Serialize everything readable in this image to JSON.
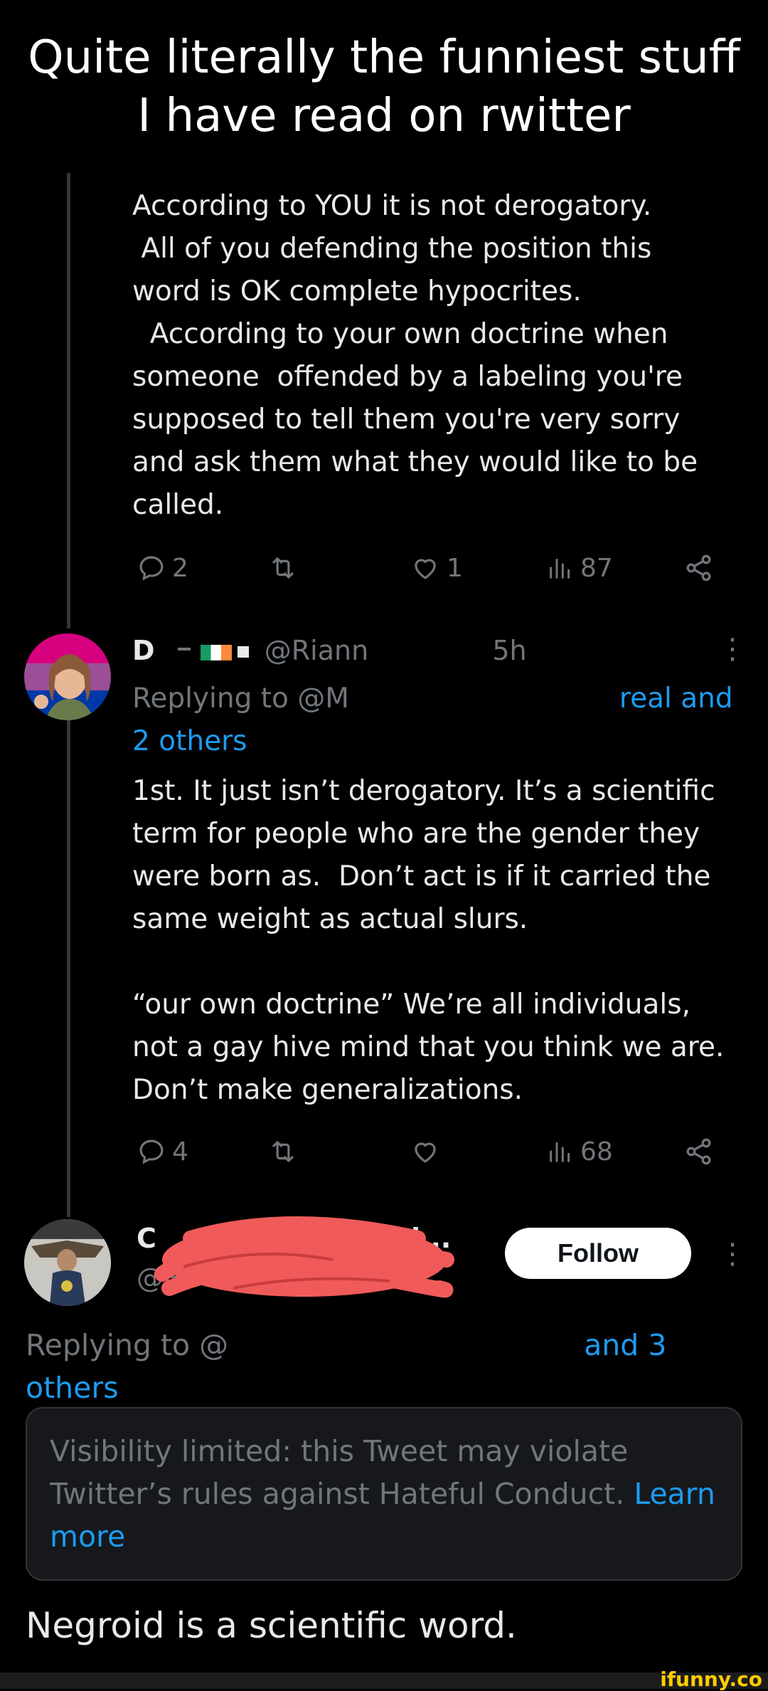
{
  "caption": {
    "line1": "Quite literally the funniest stuff",
    "line2": "I have read on rwitter"
  },
  "tweet1": {
    "lines": [
      "According to YOU it is not derogatory.",
      " All of you defending the position this",
      "word is OK complete hypocrites.",
      "  According to your own doctrine when",
      "someone  offended by a labeling you're",
      "supposed to tell them you're very sorry",
      "and ask them what they would like to be",
      "called."
    ],
    "replies": "2",
    "likes": "1",
    "views": "87"
  },
  "tweet2": {
    "name": "D",
    "handle": "@Riann",
    "time": "5h",
    "replying_prefix": "Replying to @M",
    "replying_suffix": "real and",
    "replying_line2": "2 others",
    "paragraph1": [
      "1st. It just isn’t derogatory. It’s a scientific",
      "term for people who are the gender they",
      "were born as.  Don’t act is if it carried the",
      "same weight as actual slurs."
    ],
    "paragraph2": [
      "“our own doctrine” We’re all individuals,",
      "not a gay hive mind that you think we are.",
      "Don’t make generalizations."
    ],
    "replies": "4",
    "views": "68"
  },
  "tweet3": {
    "name_visible": "C",
    "name_tail": "l...",
    "handle_visible": "@H",
    "follow_label": "Follow",
    "replying_line1": "Replying to @",
    "replying_tail": "and 3",
    "replying_line2": "others",
    "notice_text": "Visibility limited: this Tweet may violate Twitter’s rules against Hateful Conduct.",
    "notice_link": "Learn more",
    "body": "Negroid is a scientific word."
  },
  "watermark": "ifunny.co",
  "colors": {
    "background": "#000000",
    "text": "#e7e9ea",
    "muted": "#71767b",
    "link": "#1d9bf0",
    "scribble": "#f05a5a"
  },
  "icons": [
    "reply-icon",
    "retweet-icon",
    "like-icon",
    "views-icon",
    "share-icon",
    "more-icon"
  ]
}
